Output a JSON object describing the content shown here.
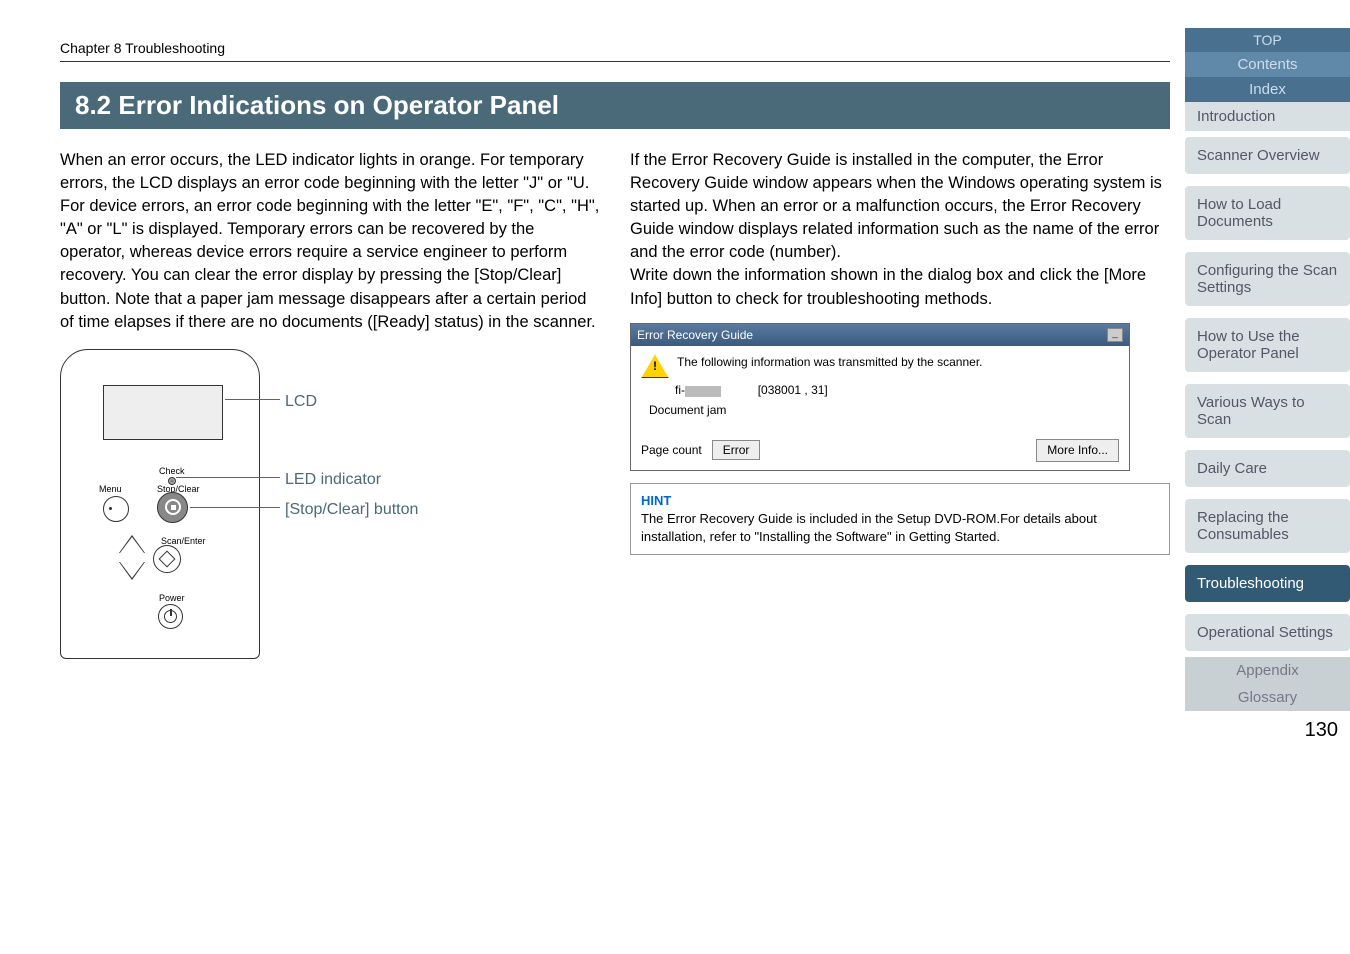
{
  "chapter": "Chapter 8 Troubleshooting",
  "section_number": "8.2",
  "section_title": "Error Indications on Operator Panel",
  "left_paragraph": "When an error occurs, the LED indicator lights in orange. For temporary errors, the LCD displays an error code beginning with the letter \"J\" or \"U. For device errors, an error code beginning with the letter \"E\", \"F\", \"C\", \"H\", \"A\" or \"L\" is displayed. Temporary errors can be recovered by the operator, whereas device errors require a service engineer to perform recovery. You can clear the error display by pressing the [Stop/Clear] button. Note that a paper jam message disappears after a certain period of time elapses if there are no documents ([Ready] status) in the scanner.",
  "right_paragraph_1": "If the Error Recovery Guide is installed in the computer, the Error Recovery Guide window appears when the Windows operating system is started up. When an error or a malfunction occurs, the Error Recovery Guide window displays related information such as the name of the error and the error code (number).",
  "right_paragraph_2": "Write down the information shown in the dialog box and click the [More Info] button to check for troubleshooting methods.",
  "diagram": {
    "lcd_label": "LCD",
    "led_label": "LED indicator",
    "stopclear_label": "[Stop/Clear] button",
    "check": "Check",
    "menu": "Menu",
    "stopclear": "Stop/Clear",
    "scanenter": "Scan/Enter",
    "power": "Power"
  },
  "erg": {
    "title": "Error Recovery Guide",
    "message": "The following information was transmitted by the scanner.",
    "model_prefix": "fi-",
    "code": "[038001 , 31]",
    "docjam": "Document jam",
    "pagecount": "Page count",
    "error_btn": "Error",
    "moreinfo_btn": "More Info..."
  },
  "hint": {
    "label": "HINT",
    "text": "The Error Recovery Guide is included in the Setup DVD-ROM.For details about installation, refer to \"Installing the Software\" in Getting Started."
  },
  "nav": {
    "top": "TOP",
    "contents": "Contents",
    "index": "Index",
    "introduction": "Introduction",
    "items": [
      "Scanner Overview",
      "How to Load Documents",
      "Configuring the Scan Settings",
      "How to Use the Operator Panel",
      "Various Ways to Scan",
      "Daily Care",
      "Replacing the Consumables",
      "Troubleshooting",
      "Operational Settings"
    ],
    "appendix": "Appendix",
    "glossary": "Glossary"
  },
  "page_number": "130"
}
